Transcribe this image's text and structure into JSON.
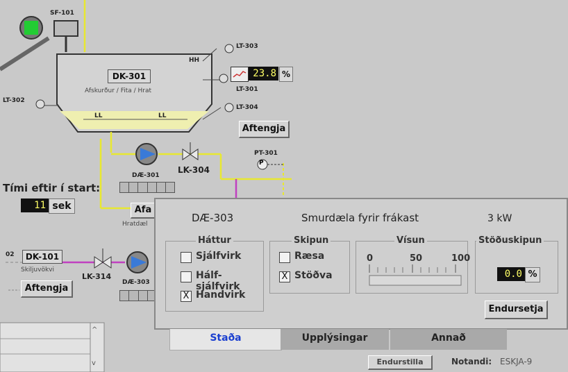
{
  "process": {
    "fan_tag": "SF-101",
    "tank_tag": "DK-301",
    "tank_desc": "Afskurður / Fita / Hrat",
    "level_hh": "HH",
    "level_ll_left": "LL",
    "level_ll_right": "LL",
    "lt303": "LT-303",
    "lt301": "LT-301",
    "lt302": "LT-302",
    "lt304": "LT-304",
    "level_value": "23.8",
    "level_unit": "%",
    "aftengja_top": "Aftengja",
    "pump301_tag": "DÆ-301",
    "valve304_tag": "LK-304",
    "pt301_tag": "PT-301",
    "pt_symbol": "P",
    "time_label": "Tími eftir í start:",
    "time_value": "11",
    "time_unit": "sek",
    "partial_button": "Afa",
    "partial_subtext": "Hratdæl",
    "dk101_prefix": "02",
    "dk101_tag": "DK-101",
    "dk101_desc": "Skiljuvökvi",
    "aftengja_left": "Aftengja",
    "valve314_tag": "LK-314",
    "pump303_tag": "DÆ-303",
    "bottom_text_1": "Endurstilla",
    "bottom_text_2": "Notandi:",
    "bottom_text_3": "ESKJA-9"
  },
  "popup": {
    "header_tag": "DÆ-303",
    "header_desc": "Smurdæla fyrir frákast",
    "header_power": "3 kW",
    "hattur_title": "Háttur",
    "hattur_options": [
      {
        "label": "Sjálfvirk",
        "checked": false
      },
      {
        "label": "Hálf-sjálfvirk",
        "checked": false
      },
      {
        "label": "Handvirk",
        "checked": true
      }
    ],
    "skipun_title": "Skipun",
    "skipun_options": [
      {
        "label": "Ræsa",
        "checked": false
      },
      {
        "label": "Stöðva",
        "checked": true
      }
    ],
    "visun_title": "Vísun",
    "visun_ticks": [
      "0",
      "50",
      "100"
    ],
    "visun_value": 0,
    "stodu_title": "Stöðuskipun",
    "stodu_value": "0.0",
    "stodu_unit": "%",
    "reset_button": "Endursetja",
    "tabs": [
      "Staða",
      "Upplýsingar",
      "Annað"
    ],
    "active_tab": "Staða",
    "check_mark": "X"
  }
}
